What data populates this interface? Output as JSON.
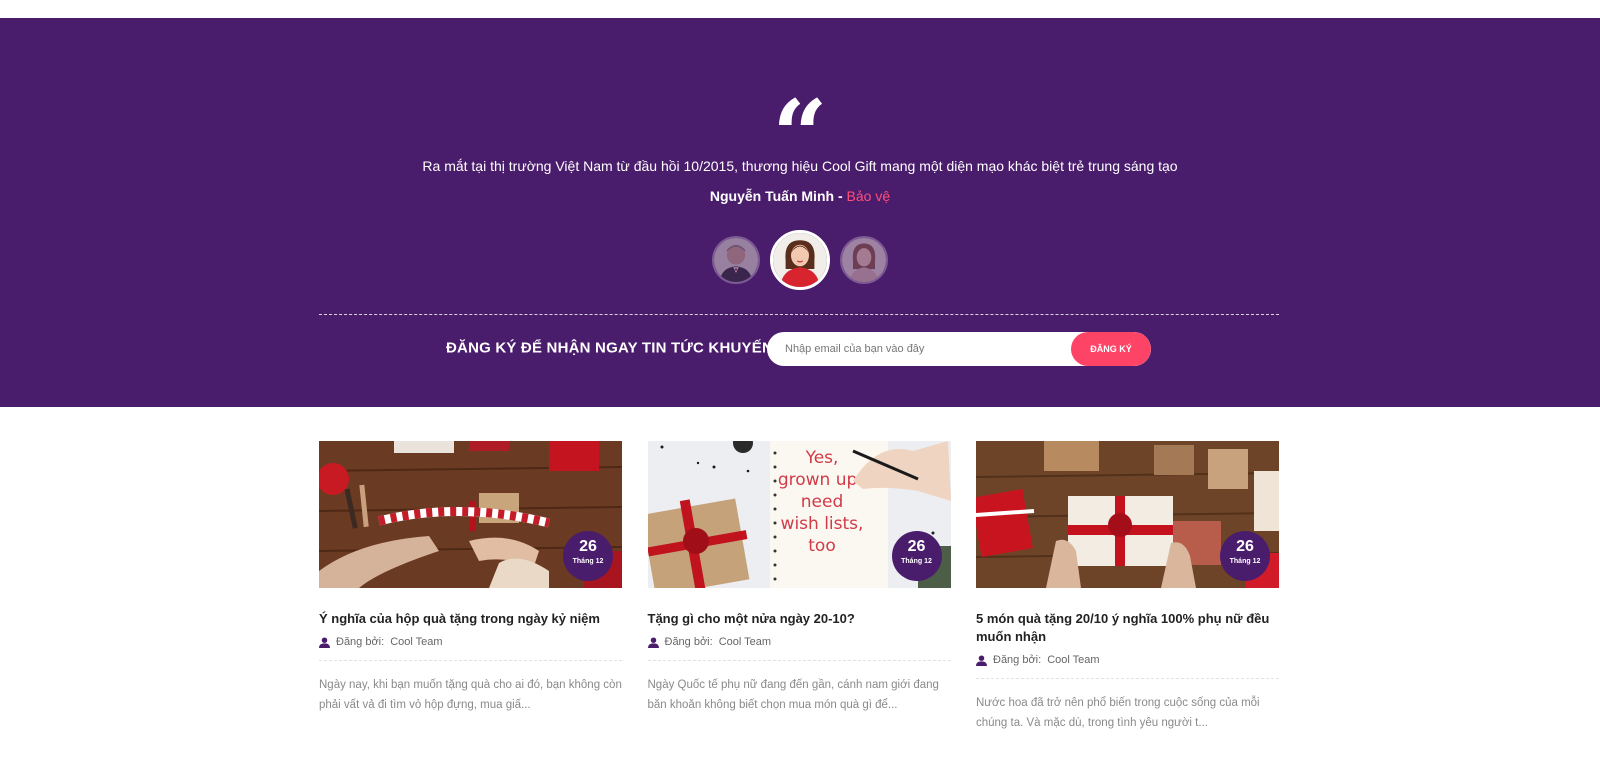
{
  "testimonial": {
    "quote_mark": "“",
    "text": "Ra mắt tại thị trường Việt Nam từ đầu hồi 10/2015, thương hiệu Cool Gift mang một diện mạo khác biệt trẻ trung sáng tạo",
    "author_name": "Nguyễn Tuấn Minh",
    "separator": " - ",
    "author_role": "Bảo vệ"
  },
  "subscribe": {
    "title": "ĐĂNG KÝ ĐỂ NHẬN NGAY TIN TỨC KHUYẾN MÃI",
    "placeholder": "Nhập email của bạn vào đây",
    "button_label": "ĐĂNG KÝ"
  },
  "posts": [
    {
      "day": "26",
      "month": "Tháng 12",
      "title": "Ý nghĩa của hộp quà tặng trong ngày kỷ niệm",
      "meta_label": "Đăng bởi:",
      "author": "Cool Team",
      "excerpt": "Ngày nay, khi bạn muốn tặng quà cho ai đó, bạn không còn phải vất vả đi tìm vỏ hộp đựng, mua giấ..."
    },
    {
      "day": "26",
      "month": "Tháng 12",
      "title": "Tặng gì cho một nửa ngày 20-10?",
      "meta_label": "Đăng bởi:",
      "author": "Cool Team",
      "excerpt": "Ngày Quốc tế phụ nữ đang đến gần, cánh nam giới đang băn khoăn không biết chọn mua món quà gì để...",
      "image_text": [
        "Yes,",
        "grown ups",
        "need",
        "wish lists,",
        "too"
      ]
    },
    {
      "day": "26",
      "month": "Tháng 12",
      "title": "5 món quà tặng 20/10 ý nghĩa 100% phụ nữ đều muốn nhận",
      "meta_label": "Đăng bởi:",
      "author": "Cool Team",
      "excerpt": "Nước hoa đã trở nên phổ biến trong cuộc sống của mỗi chúng ta. Và mặc dù, trong tình yêu người t..."
    }
  ],
  "colors": {
    "hero_bg": "#4a1c6c",
    "accent": "#fe4466",
    "badge_bg": "#4a1c6c"
  }
}
